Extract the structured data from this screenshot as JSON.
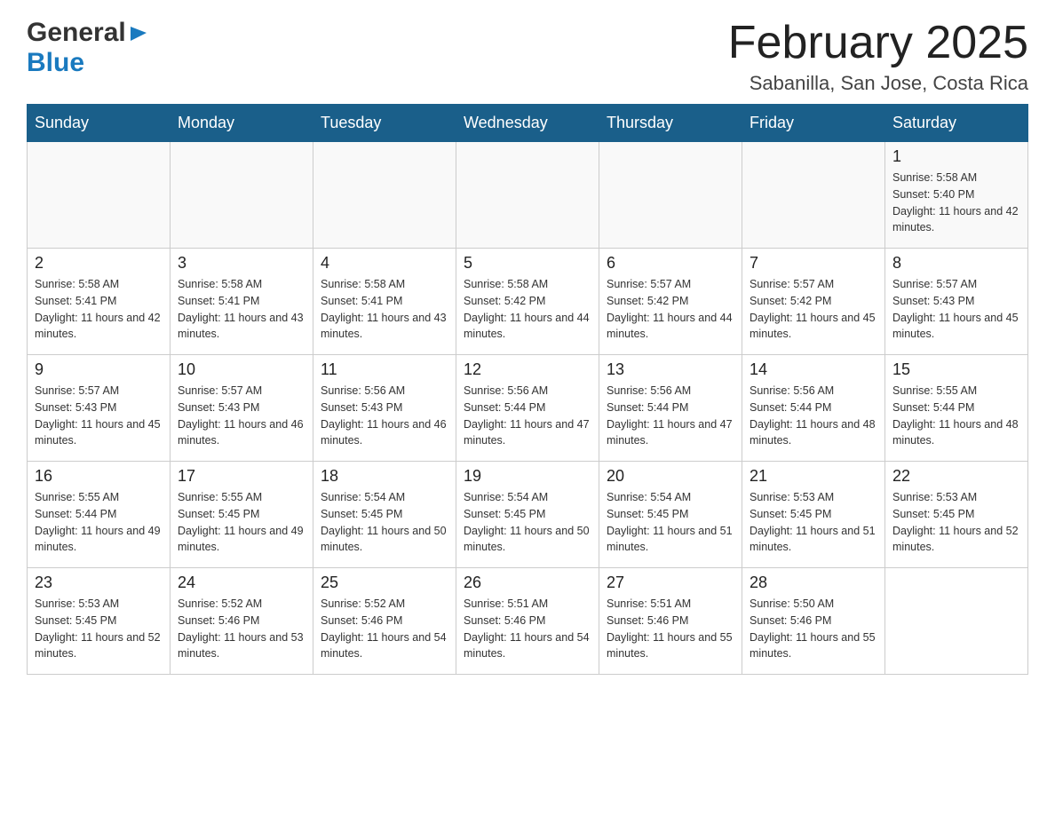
{
  "header": {
    "logo": {
      "general": "General",
      "blue": "Blue",
      "arrow": "▶"
    },
    "title": "February 2025",
    "subtitle": "Sabanilla, San Jose, Costa Rica"
  },
  "days_of_week": [
    "Sunday",
    "Monday",
    "Tuesday",
    "Wednesday",
    "Thursday",
    "Friday",
    "Saturday"
  ],
  "weeks": [
    [
      {
        "date": "",
        "sunrise": "",
        "sunset": "",
        "daylight": ""
      },
      {
        "date": "",
        "sunrise": "",
        "sunset": "",
        "daylight": ""
      },
      {
        "date": "",
        "sunrise": "",
        "sunset": "",
        "daylight": ""
      },
      {
        "date": "",
        "sunrise": "",
        "sunset": "",
        "daylight": ""
      },
      {
        "date": "",
        "sunrise": "",
        "sunset": "",
        "daylight": ""
      },
      {
        "date": "",
        "sunrise": "",
        "sunset": "",
        "daylight": ""
      },
      {
        "date": "1",
        "sunrise": "Sunrise: 5:58 AM",
        "sunset": "Sunset: 5:40 PM",
        "daylight": "Daylight: 11 hours and 42 minutes."
      }
    ],
    [
      {
        "date": "2",
        "sunrise": "Sunrise: 5:58 AM",
        "sunset": "Sunset: 5:41 PM",
        "daylight": "Daylight: 11 hours and 42 minutes."
      },
      {
        "date": "3",
        "sunrise": "Sunrise: 5:58 AM",
        "sunset": "Sunset: 5:41 PM",
        "daylight": "Daylight: 11 hours and 43 minutes."
      },
      {
        "date": "4",
        "sunrise": "Sunrise: 5:58 AM",
        "sunset": "Sunset: 5:41 PM",
        "daylight": "Daylight: 11 hours and 43 minutes."
      },
      {
        "date": "5",
        "sunrise": "Sunrise: 5:58 AM",
        "sunset": "Sunset: 5:42 PM",
        "daylight": "Daylight: 11 hours and 44 minutes."
      },
      {
        "date": "6",
        "sunrise": "Sunrise: 5:57 AM",
        "sunset": "Sunset: 5:42 PM",
        "daylight": "Daylight: 11 hours and 44 minutes."
      },
      {
        "date": "7",
        "sunrise": "Sunrise: 5:57 AM",
        "sunset": "Sunset: 5:42 PM",
        "daylight": "Daylight: 11 hours and 45 minutes."
      },
      {
        "date": "8",
        "sunrise": "Sunrise: 5:57 AM",
        "sunset": "Sunset: 5:43 PM",
        "daylight": "Daylight: 11 hours and 45 minutes."
      }
    ],
    [
      {
        "date": "9",
        "sunrise": "Sunrise: 5:57 AM",
        "sunset": "Sunset: 5:43 PM",
        "daylight": "Daylight: 11 hours and 45 minutes."
      },
      {
        "date": "10",
        "sunrise": "Sunrise: 5:57 AM",
        "sunset": "Sunset: 5:43 PM",
        "daylight": "Daylight: 11 hours and 46 minutes."
      },
      {
        "date": "11",
        "sunrise": "Sunrise: 5:56 AM",
        "sunset": "Sunset: 5:43 PM",
        "daylight": "Daylight: 11 hours and 46 minutes."
      },
      {
        "date": "12",
        "sunrise": "Sunrise: 5:56 AM",
        "sunset": "Sunset: 5:44 PM",
        "daylight": "Daylight: 11 hours and 47 minutes."
      },
      {
        "date": "13",
        "sunrise": "Sunrise: 5:56 AM",
        "sunset": "Sunset: 5:44 PM",
        "daylight": "Daylight: 11 hours and 47 minutes."
      },
      {
        "date": "14",
        "sunrise": "Sunrise: 5:56 AM",
        "sunset": "Sunset: 5:44 PM",
        "daylight": "Daylight: 11 hours and 48 minutes."
      },
      {
        "date": "15",
        "sunrise": "Sunrise: 5:55 AM",
        "sunset": "Sunset: 5:44 PM",
        "daylight": "Daylight: 11 hours and 48 minutes."
      }
    ],
    [
      {
        "date": "16",
        "sunrise": "Sunrise: 5:55 AM",
        "sunset": "Sunset: 5:44 PM",
        "daylight": "Daylight: 11 hours and 49 minutes."
      },
      {
        "date": "17",
        "sunrise": "Sunrise: 5:55 AM",
        "sunset": "Sunset: 5:45 PM",
        "daylight": "Daylight: 11 hours and 49 minutes."
      },
      {
        "date": "18",
        "sunrise": "Sunrise: 5:54 AM",
        "sunset": "Sunset: 5:45 PM",
        "daylight": "Daylight: 11 hours and 50 minutes."
      },
      {
        "date": "19",
        "sunrise": "Sunrise: 5:54 AM",
        "sunset": "Sunset: 5:45 PM",
        "daylight": "Daylight: 11 hours and 50 minutes."
      },
      {
        "date": "20",
        "sunrise": "Sunrise: 5:54 AM",
        "sunset": "Sunset: 5:45 PM",
        "daylight": "Daylight: 11 hours and 51 minutes."
      },
      {
        "date": "21",
        "sunrise": "Sunrise: 5:53 AM",
        "sunset": "Sunset: 5:45 PM",
        "daylight": "Daylight: 11 hours and 51 minutes."
      },
      {
        "date": "22",
        "sunrise": "Sunrise: 5:53 AM",
        "sunset": "Sunset: 5:45 PM",
        "daylight": "Daylight: 11 hours and 52 minutes."
      }
    ],
    [
      {
        "date": "23",
        "sunrise": "Sunrise: 5:53 AM",
        "sunset": "Sunset: 5:45 PM",
        "daylight": "Daylight: 11 hours and 52 minutes."
      },
      {
        "date": "24",
        "sunrise": "Sunrise: 5:52 AM",
        "sunset": "Sunset: 5:46 PM",
        "daylight": "Daylight: 11 hours and 53 minutes."
      },
      {
        "date": "25",
        "sunrise": "Sunrise: 5:52 AM",
        "sunset": "Sunset: 5:46 PM",
        "daylight": "Daylight: 11 hours and 54 minutes."
      },
      {
        "date": "26",
        "sunrise": "Sunrise: 5:51 AM",
        "sunset": "Sunset: 5:46 PM",
        "daylight": "Daylight: 11 hours and 54 minutes."
      },
      {
        "date": "27",
        "sunrise": "Sunrise: 5:51 AM",
        "sunset": "Sunset: 5:46 PM",
        "daylight": "Daylight: 11 hours and 55 minutes."
      },
      {
        "date": "28",
        "sunrise": "Sunrise: 5:50 AM",
        "sunset": "Sunset: 5:46 PM",
        "daylight": "Daylight: 11 hours and 55 minutes."
      },
      {
        "date": "",
        "sunrise": "",
        "sunset": "",
        "daylight": ""
      }
    ]
  ]
}
